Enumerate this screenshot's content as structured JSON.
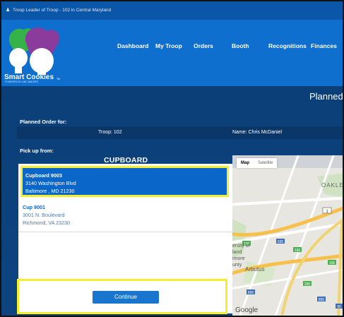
{
  "topbar": {
    "title": "Troop Leader of Troop - 102 in Central Maryland"
  },
  "logo": {
    "text": "Smart Cookies",
    "tagline": "POWERED BY ABC BAKERS",
    "tm": "TM"
  },
  "nav": {
    "items": [
      "Dashboard",
      "My Troop",
      "Orders",
      "Booth",
      "Recognitions",
      "Finances"
    ]
  },
  "page": {
    "heading": "Planned"
  },
  "order": {
    "planned_for_label": "Planned Order for:",
    "troop": "Troop: 102",
    "name": "Name: Chris McDaniel",
    "pickup_label": "Pick up from:"
  },
  "pickup": {
    "section_title": "CUPBOARD",
    "locations": [
      {
        "name": "Cupboard 9003",
        "address": "3140 Washington Blvd",
        "city": "Baltimore , MD 21230"
      },
      {
        "name": "Cup 9001",
        "address": "3001 N. Boulevard",
        "city": "Richmond, VA 23230"
      }
    ],
    "continue_label": "Continue"
  },
  "map": {
    "tabs": [
      "Map",
      "Satellite"
    ],
    "labels": [
      "OAKLE",
      "ersity of",
      "land",
      "imore",
      "unty",
      "Arbutus",
      "Google",
      "1",
      "138",
      "695",
      "166",
      "295",
      "166",
      "895",
      "895",
      "95"
    ]
  },
  "colors": {
    "header": "#0f6fcf",
    "highlight": "#f4ee2b",
    "selected": "#0b66c9",
    "button": "#1a75cf"
  }
}
